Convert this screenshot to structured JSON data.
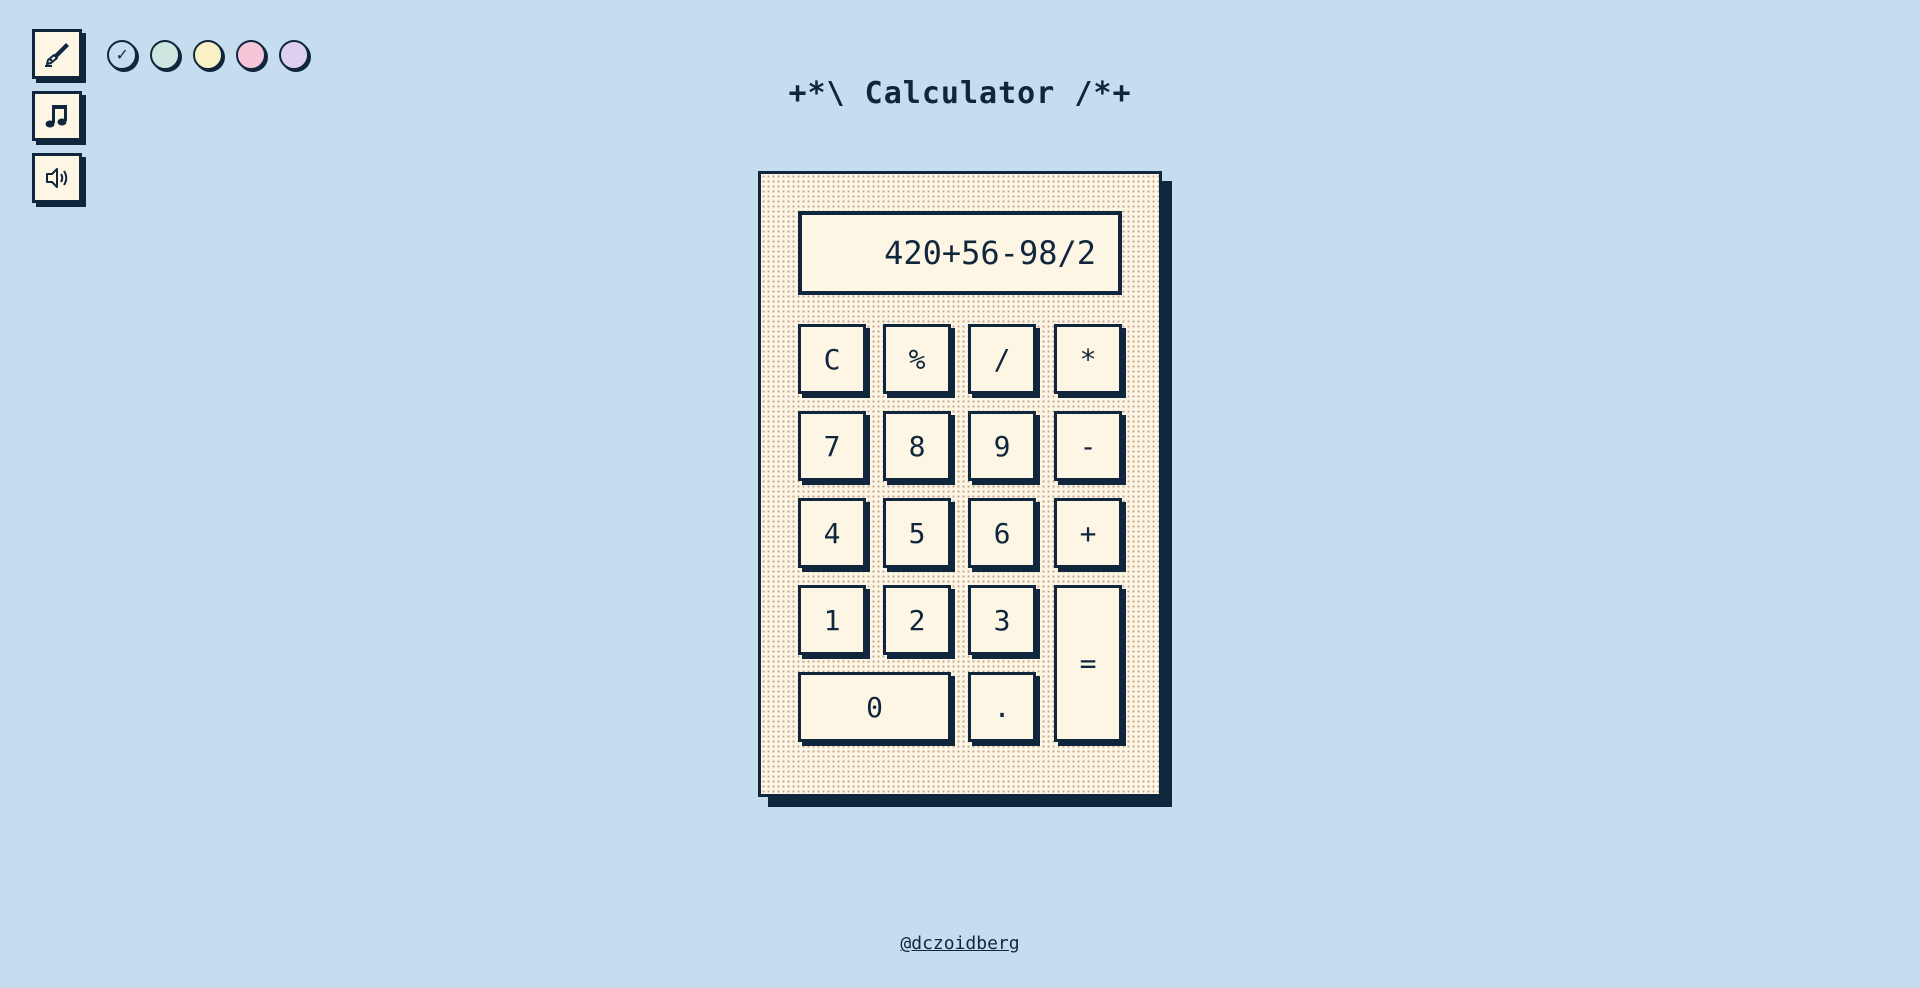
{
  "toolbar": {
    "icons": [
      "pen-icon",
      "music-note-icon",
      "speaker-icon"
    ]
  },
  "theme_swatches": [
    {
      "color": "#c6ddf0",
      "selected": true,
      "mark": "✓"
    },
    {
      "color": "#cde6df",
      "selected": false,
      "mark": ""
    },
    {
      "color": "#faf0c6",
      "selected": false,
      "mark": ""
    },
    {
      "color": "#f4c6d8",
      "selected": false,
      "mark": ""
    },
    {
      "color": "#ddd0ef",
      "selected": false,
      "mark": ""
    }
  ],
  "title": "+*\\ Calculator /*+",
  "calculator": {
    "display": "420+56-98/2",
    "keys": {
      "clear": "C",
      "percent": "%",
      "divide": "/",
      "multiply": "*",
      "seven": "7",
      "eight": "8",
      "nine": "9",
      "minus": "-",
      "four": "4",
      "five": "5",
      "six": "6",
      "plus": "+",
      "one": "1",
      "two": "2",
      "three": "3",
      "equals": "=",
      "zero": "0",
      "decimal": "."
    }
  },
  "footer": {
    "credit": "@dczoidberg"
  },
  "colors": {
    "background": "#c6ddf0",
    "ink": "#10263d",
    "paper": "#fdf6e4",
    "dots": "#c4a894"
  }
}
